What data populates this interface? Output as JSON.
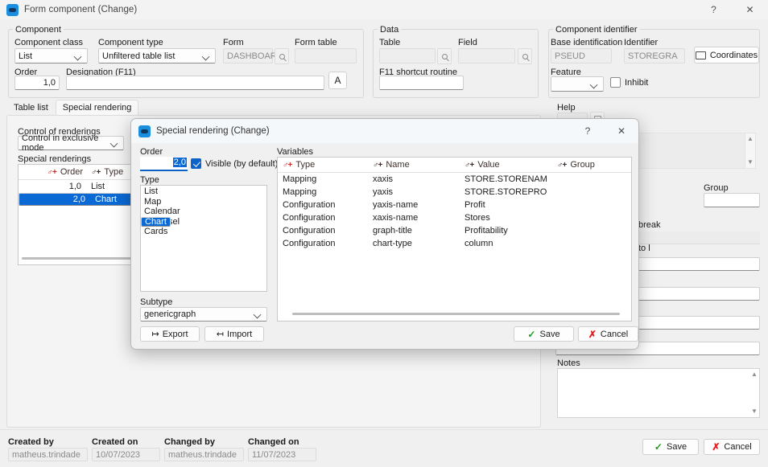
{
  "window": {
    "title": "Form component (Change)",
    "help_btn": "?",
    "close_btn": "✕"
  },
  "component_group": {
    "legend": "Component",
    "component_class": {
      "label": "Component class",
      "value": "List"
    },
    "component_type": {
      "label": "Component type",
      "value": "Unfiltered table list"
    },
    "form": {
      "label": "Form",
      "value": "DASHBOAR"
    },
    "form_table": {
      "label": "Form table",
      "value": ""
    },
    "order": {
      "label": "Order",
      "value": "1,0"
    },
    "designation": {
      "label": "Designation (F11)",
      "value": "",
      "translate_btn": "A"
    }
  },
  "data_group": {
    "legend": "Data",
    "table": {
      "label": "Table",
      "value": ""
    },
    "field": {
      "label": "Field",
      "value": ""
    },
    "f11_routine": {
      "label": "F11 shortcut routine",
      "value": ""
    }
  },
  "identifier_group": {
    "legend": "Component identifier",
    "base_identification": {
      "label": "Base identification",
      "value": "PSEUD"
    },
    "identifier": {
      "label": "Identifier",
      "value": "STOREGRA"
    },
    "coordinates_btn": "Coordinates",
    "feature": {
      "label": "Feature",
      "value": ""
    },
    "inhibit": {
      "label": "Inhibit",
      "checked": false
    }
  },
  "help_label": "Help",
  "tabs": [
    {
      "label": "Table list",
      "active": false
    },
    {
      "label": "Special rendering",
      "active": true
    }
  ],
  "special_rendering_panel": {
    "control_label": "Control of renderings",
    "control_value": "Control in exclusive mode",
    "list_label": "Special renderings",
    "columns": [
      "Order",
      "Type"
    ],
    "rows": [
      {
        "order": "1,0",
        "type": "List",
        "selected": false
      },
      {
        "order": "2,0",
        "type": "Chart",
        "selected": true
      }
    ]
  },
  "right_panel": {
    "group_label": "Group",
    "group_value": "",
    "break_label": "break",
    "to_label": "to l",
    "notes_label": "Notes",
    "notes_value": ""
  },
  "modal": {
    "title": "Special rendering (Change)",
    "help_btn": "?",
    "close_btn": "✕",
    "order": {
      "label": "Order",
      "value": "2,0"
    },
    "visible": {
      "label": "Visible (by default)",
      "checked": true
    },
    "type": {
      "label": "Type",
      "options": [
        "List",
        "Map",
        "Calendar",
        "Chart",
        "Carousel",
        "Cards"
      ],
      "selected": "Chart"
    },
    "subtype": {
      "label": "Subtype",
      "value": "genericgraph"
    },
    "export_btn": "Export",
    "import_btn": "Import",
    "variables": {
      "label": "Variables",
      "columns": [
        "Type",
        "Name",
        "Value",
        "Group"
      ],
      "rows": [
        {
          "type": "Mapping",
          "name": "xaxis",
          "value": "STORE.STORENAM",
          "group": ""
        },
        {
          "type": "Mapping",
          "name": "yaxis",
          "value": "STORE.STOREPRO",
          "group": ""
        },
        {
          "type": "Configuration",
          "name": "yaxis-name",
          "value": "Profit",
          "group": ""
        },
        {
          "type": "Configuration",
          "name": "xaxis-name",
          "value": "Stores",
          "group": ""
        },
        {
          "type": "Configuration",
          "name": "graph-title",
          "value": "Profitability",
          "group": ""
        },
        {
          "type": "Configuration",
          "name": "chart-type",
          "value": "column",
          "group": ""
        }
      ]
    },
    "save_btn": "Save",
    "cancel_btn": "Cancel"
  },
  "footer": {
    "created_by": {
      "label": "Created by",
      "value": "matheus.trindade"
    },
    "created_on": {
      "label": "Created on",
      "value": "10/07/2023"
    },
    "changed_by": {
      "label": "Changed by",
      "value": "matheus.trindade"
    },
    "changed_on": {
      "label": "Changed on",
      "value": "11/07/2023"
    },
    "save_btn": "Save",
    "cancel_btn": "Cancel"
  },
  "colors": {
    "accent": "#0a69d4",
    "save_green": "#1f9d1f",
    "cancel_red": "#e02020",
    "sort_red": "#cc2b2b",
    "window_bg": "#f0f0f0"
  }
}
